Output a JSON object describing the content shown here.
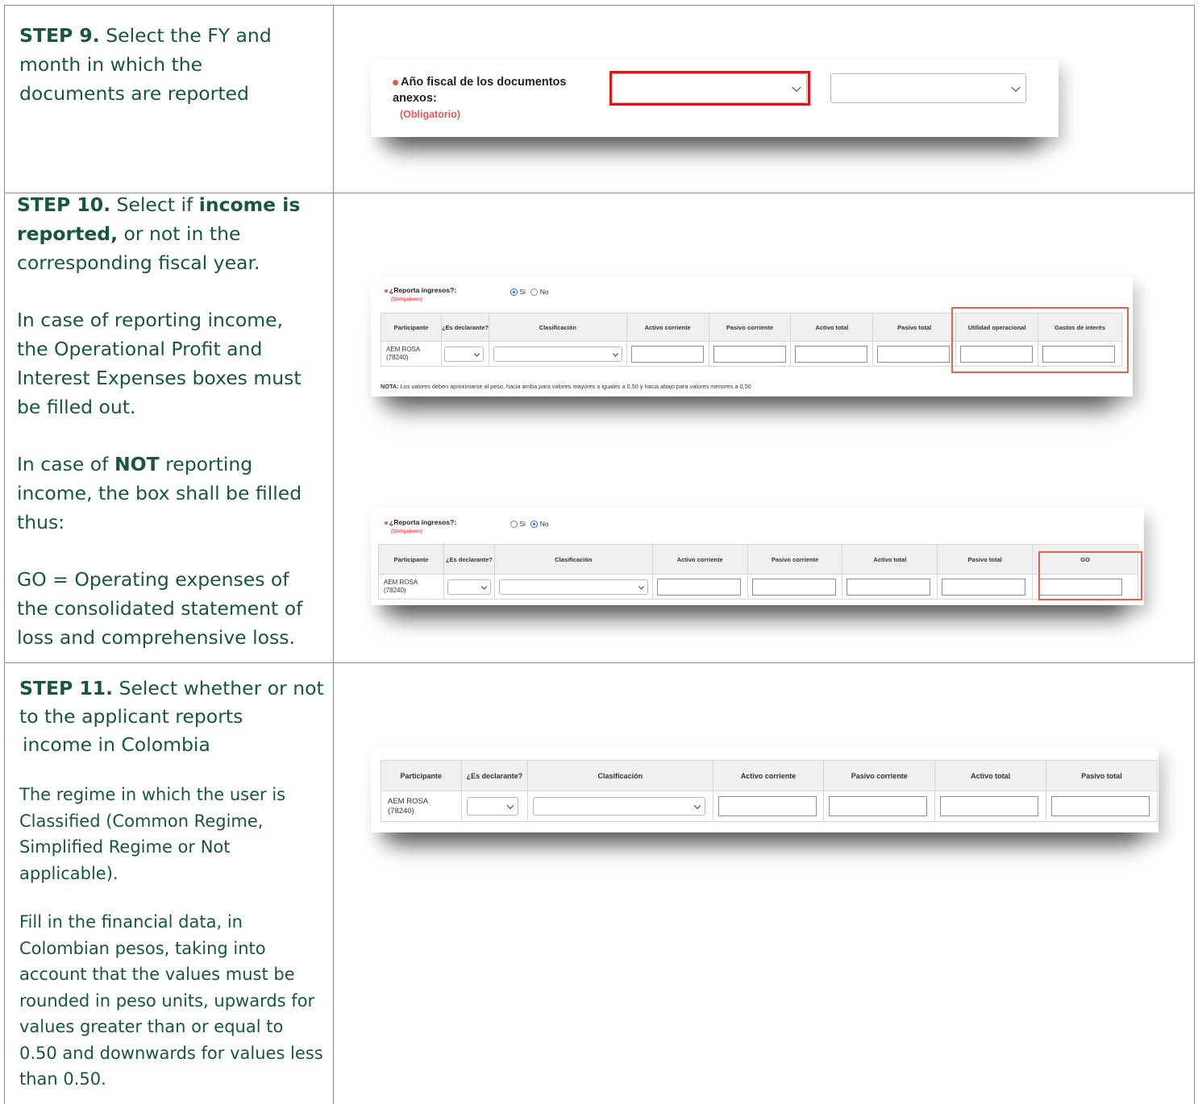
{
  "step9": {
    "step": "STEP 9.",
    "text": "Select the FY and month in which the documents are reported",
    "screenshot": {
      "label": "Año fiscal de los documentos anexos:",
      "required": "(Obligatorio)"
    }
  },
  "step10": {
    "step": "STEP 10.",
    "text_pre": "Select if",
    "text_bold": "income is reported,",
    "text_post": "or not in the corresponding fiscal year.",
    "para2": "In case of reporting income, the Operational Profit and Interest Expenses boxes must be filled out.",
    "para3_pre": "In case of",
    "para3_bold": "NOT",
    "para3_post": "reporting income, the box shall be filled thus:",
    "para4": "GO = Operating expenses of the consolidated statement of loss and comprehensive loss.",
    "shot1": {
      "question": "¿Reporta ingresos?:",
      "required": "(Obligatorio)",
      "radio_yes": "Si",
      "radio_no": "No",
      "headers": [
        "Participante",
        "¿Es declarante?",
        "Clasificación",
        "Activo corriente",
        "Pasivo corriente",
        "Activo total",
        "Pasivo total",
        "Utilidad operacional",
        "Gastos de interés"
      ],
      "participant": "AEM ROSA",
      "participant_id": "(78240)",
      "note_bold": "NOTA:",
      "note": "Los valores deben aproximarse al peso, hacia arriba para valores mayores o iguales a 0,50 y hacia abajo para valores menores a 0,50"
    },
    "shot2": {
      "question": "¿Reporta ingresos?:",
      "required": "(Obligatorio)",
      "radio_yes": "Si",
      "radio_no": "No",
      "headers": [
        "Participante",
        "¿Es declarante?",
        "Clasificación",
        "Activo corriente",
        "Pasivo corriente",
        "Activo total",
        "Pasivo total",
        "GO"
      ],
      "participant": "AEM ROSA",
      "participant_id": "(78240)"
    }
  },
  "step11": {
    "step": "STEP 11.",
    "text": "Select whether or not to the applicant reports",
    "text2": "income in Colombia",
    "para2": "The regime in which the user is Classified (Common Regime, Simplified Regime or Not applicable).",
    "para3": "Fill in the financial data, in Colombian pesos, taking into account that the values must be rounded in peso units, upwards for values greater than or equal to 0.50 and downwards for values less than 0.50.",
    "shot": {
      "headers": [
        "Participante",
        "¿Es declarante?",
        "Clasificación",
        "Activo corriente",
        "Pasivo corriente",
        "Activo total",
        "Pasivo total"
      ],
      "participant": "AEM ROSA",
      "participant_id": "(78240)"
    }
  },
  "colors": {
    "text_green": "#17573a",
    "required_red": "#e85757",
    "highlight_red": "#d21a1a",
    "highlight_orange": "#e8614b",
    "radio_blue": "#2b6bd6"
  }
}
